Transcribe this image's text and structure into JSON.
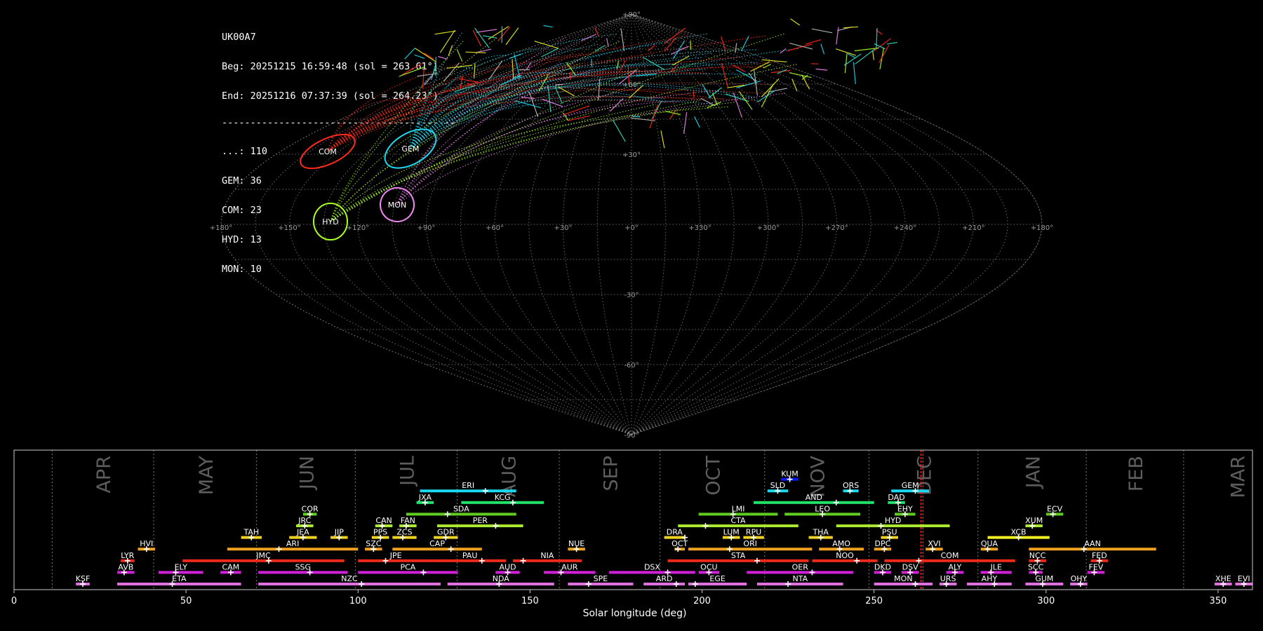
{
  "header": {
    "station": "UK00A7",
    "begin": "Beg: 20251215 16:59:48 (sol = 263.61°)",
    "end": "End: 20251216 07:37:39 (sol = 264.23°)",
    "separator": "-----------------------------------------",
    "counts": [
      {
        "label": "...: 110"
      },
      {
        "label": "GEM: 36"
      },
      {
        "label": "COM: 23"
      },
      {
        "label": "HYD: 13"
      },
      {
        "label": "MON: 10"
      }
    ]
  },
  "sky_map": {
    "lat_labels": [
      "+90°",
      "+60°",
      "+30°",
      "-30°",
      "-60°",
      "-90°"
    ],
    "lon_labels": [
      "+180°",
      "+150°",
      "+120°",
      "+90°",
      "+60°",
      "+30°",
      "+0°",
      "+330°",
      "+300°",
      "+270°",
      "+240°",
      "+210°",
      "+180°"
    ],
    "radiants": [
      {
        "code": "COM",
        "color": "#ff2a1a"
      },
      {
        "code": "GEM",
        "color": "#1fd8f0"
      },
      {
        "code": "MON",
        "color": "#ee88ee"
      },
      {
        "code": "HYD",
        "color": "#aaff22"
      }
    ]
  },
  "chart_data": {
    "type": "timeline",
    "xlabel": "Solar longitude (deg)",
    "xlim": [
      0,
      360
    ],
    "xticks": [
      0,
      50,
      100,
      150,
      200,
      250,
      300,
      350
    ],
    "current_sol": [
      263.61,
      264.23
    ],
    "months": [
      {
        "name": "APR",
        "start": 11.1
      },
      {
        "name": "MAY",
        "start": 40.6
      },
      {
        "name": "JUN",
        "start": 70.5
      },
      {
        "name": "JUL",
        "start": 99.2
      },
      {
        "name": "AUG",
        "start": 128.8
      },
      {
        "name": "SEP",
        "start": 158.5
      },
      {
        "name": "OCT",
        "start": 187.8
      },
      {
        "name": "NOV",
        "start": 218.2
      },
      {
        "name": "DEC",
        "start": 248.5
      },
      {
        "name": "JAN",
        "start": 280.2
      },
      {
        "name": "FEB",
        "start": 311.7
      },
      {
        "name": "MAR",
        "start": 340.0
      }
    ],
    "showers": [
      {
        "code": "KUM",
        "start": 223,
        "end": 228,
        "peak": 225.5,
        "row": 9,
        "color": "#0a1aee"
      },
      {
        "code": "ERI",
        "start": 118,
        "end": 146,
        "peak": 137,
        "row": 8,
        "color": "#1ad8f0"
      },
      {
        "code": "SLD",
        "start": 219,
        "end": 225,
        "peak": 222,
        "row": 8,
        "color": "#1ad8f0"
      },
      {
        "code": "ORS",
        "start": 241,
        "end": 245.5,
        "peak": 243,
        "row": 8,
        "color": "#1ad8f0"
      },
      {
        "code": "GEM",
        "start": 255,
        "end": 266,
        "peak": 262,
        "row": 8,
        "color": "#1ad8f0"
      },
      {
        "code": "JXA",
        "start": 117,
        "end": 122,
        "peak": 119.5,
        "row": 7,
        "color": "#22e36a"
      },
      {
        "code": "KCG",
        "start": 130,
        "end": 154,
        "peak": 145,
        "row": 7,
        "color": "#22e36a"
      },
      {
        "code": "AND",
        "start": 215,
        "end": 250,
        "peak": 239,
        "row": 7,
        "color": "#22e36a"
      },
      {
        "code": "DAD",
        "start": 254,
        "end": 259,
        "peak": 257,
        "row": 7,
        "color": "#22e36a"
      },
      {
        "code": "COR",
        "start": 84,
        "end": 88,
        "peak": 86,
        "row": 6,
        "color": "#5fcc22"
      },
      {
        "code": "SDA",
        "start": 114,
        "end": 146,
        "peak": 126,
        "row": 6,
        "color": "#5fcc22"
      },
      {
        "code": "LMI",
        "start": 199,
        "end": 222,
        "peak": 209,
        "row": 6,
        "color": "#5fcc22"
      },
      {
        "code": "LEO",
        "start": 224,
        "end": 246,
        "peak": 235,
        "row": 6,
        "color": "#5fcc22"
      },
      {
        "code": "EHY",
        "start": 256,
        "end": 262,
        "peak": 259,
        "row": 6,
        "color": "#5fcc22"
      },
      {
        "code": "ECV",
        "start": 300,
        "end": 305,
        "peak": 302,
        "row": 6,
        "color": "#5fcc22"
      },
      {
        "code": "JRC",
        "start": 82,
        "end": 87,
        "peak": 84.5,
        "row": 5,
        "color": "#a8e830"
      },
      {
        "code": "CAN",
        "start": 105,
        "end": 110,
        "peak": 107,
        "row": 5,
        "color": "#a8e830"
      },
      {
        "code": "FAN",
        "start": 112,
        "end": 117,
        "peak": 114,
        "row": 5,
        "color": "#a8e830"
      },
      {
        "code": "PER",
        "start": 123,
        "end": 148,
        "peak": 140,
        "row": 5,
        "color": "#a8e830"
      },
      {
        "code": "CTA",
        "start": 193,
        "end": 228,
        "peak": 201,
        "row": 5,
        "color": "#a8e830"
      },
      {
        "code": "HYD",
        "start": 239,
        "end": 272,
        "peak": 252,
        "row": 5,
        "color": "#a8e830"
      },
      {
        "code": "XUM",
        "start": 294,
        "end": 299,
        "peak": 296,
        "row": 5,
        "color": "#a8e830"
      },
      {
        "code": "TAH",
        "start": 66,
        "end": 72,
        "peak": 69,
        "row": 4,
        "color": "#f0d020"
      },
      {
        "code": "JEA",
        "start": 80,
        "end": 88,
        "peak": 84,
        "row": 4,
        "color": "#f0d020"
      },
      {
        "code": "JIP",
        "start": 92,
        "end": 97,
        "peak": 94.5,
        "row": 4,
        "color": "#f0d020"
      },
      {
        "code": "PPS",
        "start": 104,
        "end": 109,
        "peak": 106.5,
        "row": 4,
        "color": "#f0d020"
      },
      {
        "code": "ZCS",
        "start": 110,
        "end": 117,
        "peak": 113,
        "row": 4,
        "color": "#f0d020"
      },
      {
        "code": "GDR",
        "start": 122,
        "end": 129,
        "peak": 125.5,
        "row": 4,
        "color": "#f0d020"
      },
      {
        "code": "DRA",
        "start": 189,
        "end": 195,
        "peak": 195,
        "row": 4,
        "color": "#f0d020"
      },
      {
        "code": "LUM",
        "start": 206,
        "end": 211,
        "peak": 208.5,
        "row": 4,
        "color": "#f0d020"
      },
      {
        "code": "RPU",
        "start": 212,
        "end": 218,
        "peak": 215,
        "row": 4,
        "color": "#f0d020"
      },
      {
        "code": "THA",
        "start": 231,
        "end": 238,
        "peak": 234.5,
        "row": 4,
        "color": "#f0d020"
      },
      {
        "code": "PSU",
        "start": 252,
        "end": 257,
        "peak": 254.5,
        "row": 4,
        "color": "#f0d020"
      },
      {
        "code": "XCB",
        "start": 283,
        "end": 301,
        "peak": 292,
        "row": 4,
        "color": "#f0f020"
      },
      {
        "code": "HVI",
        "start": 36,
        "end": 41,
        "peak": 38.5,
        "row": 3,
        "color": "#f0a020"
      },
      {
        "code": "ARI",
        "start": 62,
        "end": 100,
        "peak": 77,
        "row": 3,
        "color": "#f0a020"
      },
      {
        "code": "SZC",
        "start": 102,
        "end": 107,
        "peak": 104.5,
        "row": 3,
        "color": "#f0a020"
      },
      {
        "code": "CAP",
        "start": 110,
        "end": 136,
        "peak": 127,
        "row": 3,
        "color": "#f0a020"
      },
      {
        "code": "NUE",
        "start": 161,
        "end": 166,
        "peak": 163.5,
        "row": 3,
        "color": "#f0a020"
      },
      {
        "code": "OCT",
        "start": 192,
        "end": 195,
        "peak": 193,
        "row": 3,
        "color": "#f0a020"
      },
      {
        "code": "ORI",
        "start": 196,
        "end": 232,
        "peak": 208,
        "row": 3,
        "color": "#f0a020"
      },
      {
        "code": "AMO",
        "start": 234,
        "end": 247,
        "peak": 240,
        "row": 3,
        "color": "#f0a020"
      },
      {
        "code": "DPC",
        "start": 250,
        "end": 255,
        "peak": 253,
        "row": 3,
        "color": "#f0a020"
      },
      {
        "code": "XVI",
        "start": 265,
        "end": 270,
        "peak": 267,
        "row": 3,
        "color": "#f0a020"
      },
      {
        "code": "QUA",
        "start": 281,
        "end": 286,
        "peak": 283,
        "row": 3,
        "color": "#f0a020"
      },
      {
        "code": "AAN",
        "start": 295,
        "end": 332,
        "peak": 311,
        "row": 3,
        "color": "#f0a020"
      },
      {
        "code": "LYR",
        "start": 31,
        "end": 35,
        "peak": 33,
        "row": 2,
        "color": "#ee2a1a"
      },
      {
        "code": "JMC",
        "start": 49,
        "end": 96,
        "peak": 74,
        "row": 2,
        "color": "#ee2a1a"
      },
      {
        "code": "JPE",
        "start": 100,
        "end": 122,
        "peak": 108,
        "row": 2,
        "color": "#ee2a1a"
      },
      {
        "code": "PAU",
        "start": 122,
        "end": 143,
        "peak": 136,
        "row": 2,
        "color": "#ee2a1a"
      },
      {
        "code": "NIA",
        "start": 145,
        "end": 165,
        "peak": 148,
        "row": 2,
        "color": "#ee2a1a"
      },
      {
        "code": "STA",
        "start": 190,
        "end": 231,
        "peak": 216,
        "row": 2,
        "color": "#ee2a1a"
      },
      {
        "code": "NOO",
        "start": 232,
        "end": 251,
        "peak": 245,
        "row": 2,
        "color": "#ee2a1a"
      },
      {
        "code": "COM",
        "start": 253,
        "end": 291,
        "peak": 263,
        "row": 2,
        "color": "#ee2a1a"
      },
      {
        "code": "NCC",
        "start": 295,
        "end": 300,
        "peak": 297.5,
        "row": 2,
        "color": "#ee2a1a"
      },
      {
        "code": "FED",
        "start": 313,
        "end": 318,
        "peak": 315.5,
        "row": 2,
        "color": "#ee2a1a"
      },
      {
        "code": "AVB",
        "start": 30,
        "end": 35,
        "peak": 32,
        "row": 1,
        "color": "#d020d8"
      },
      {
        "code": "ELY",
        "start": 42,
        "end": 55,
        "peak": 47,
        "row": 1,
        "color": "#d020d8"
      },
      {
        "code": "CAM",
        "start": 60,
        "end": 66,
        "peak": 63,
        "row": 1,
        "color": "#d020d8"
      },
      {
        "code": "SSG",
        "start": 71,
        "end": 97,
        "peak": 86,
        "row": 1,
        "color": "#d020d8"
      },
      {
        "code": "PCA",
        "start": 100,
        "end": 129,
        "peak": 119,
        "row": 1,
        "color": "#d020d8"
      },
      {
        "code": "AUD",
        "start": 140,
        "end": 147,
        "peak": 143.5,
        "row": 1,
        "color": "#d020d8"
      },
      {
        "code": "AUR",
        "start": 154,
        "end": 169,
        "peak": 159,
        "row": 1,
        "color": "#d020d8"
      },
      {
        "code": "DSX",
        "start": 173,
        "end": 198,
        "peak": 190,
        "row": 1,
        "color": "#d020d8"
      },
      {
        "code": "OCU",
        "start": 199,
        "end": 205,
        "peak": 202,
        "row": 1,
        "color": "#d020d8"
      },
      {
        "code": "OER",
        "start": 213,
        "end": 244,
        "peak": 232,
        "row": 1,
        "color": "#d020d8"
      },
      {
        "code": "DKD",
        "start": 250,
        "end": 255,
        "peak": 252.5,
        "row": 1,
        "color": "#d020d8"
      },
      {
        "code": "DSV",
        "start": 258,
        "end": 263,
        "peak": 260.5,
        "row": 1,
        "color": "#d020d8"
      },
      {
        "code": "ALY",
        "start": 271,
        "end": 276,
        "peak": 273.5,
        "row": 1,
        "color": "#d020d8"
      },
      {
        "code": "JLE",
        "start": 281,
        "end": 290,
        "peak": 284,
        "row": 1,
        "color": "#d020d8"
      },
      {
        "code": "SCC",
        "start": 295,
        "end": 299,
        "peak": 297,
        "row": 1,
        "color": "#d020d8"
      },
      {
        "code": "FEV",
        "start": 312,
        "end": 317,
        "peak": 314,
        "row": 1,
        "color": "#d020d8"
      },
      {
        "code": "KSF",
        "start": 18,
        "end": 22,
        "peak": 20,
        "row": 0,
        "color": "#e070e0"
      },
      {
        "code": "ETA",
        "start": 30,
        "end": 66,
        "peak": 46,
        "row": 0,
        "color": "#e070e0"
      },
      {
        "code": "NZC",
        "start": 71,
        "end": 124,
        "peak": 101,
        "row": 0,
        "color": "#e070e0"
      },
      {
        "code": "NDA",
        "start": 126,
        "end": 157,
        "peak": 141,
        "row": 0,
        "color": "#e070e0"
      },
      {
        "code": "SPE",
        "start": 161,
        "end": 180,
        "peak": 167,
        "row": 0,
        "color": "#e070e0"
      },
      {
        "code": "ARD",
        "start": 183,
        "end": 195,
        "peak": 192.5,
        "row": 0,
        "color": "#e070e0"
      },
      {
        "code": "EGE",
        "start": 196,
        "end": 213,
        "peak": 198,
        "row": 0,
        "color": "#e070e0"
      },
      {
        "code": "NTA",
        "start": 216,
        "end": 241,
        "peak": 225,
        "row": 0,
        "color": "#e070e0"
      },
      {
        "code": "MON",
        "start": 250,
        "end": 267,
        "peak": 262,
        "row": 0,
        "color": "#e070e0"
      },
      {
        "code": "URS",
        "start": 269,
        "end": 274,
        "peak": 271,
        "row": 0,
        "color": "#e070e0"
      },
      {
        "code": "AHY",
        "start": 277,
        "end": 290,
        "peak": 285,
        "row": 0,
        "color": "#e070e0"
      },
      {
        "code": "GUM",
        "start": 294,
        "end": 305,
        "peak": 299,
        "row": 0,
        "color": "#e070e0"
      },
      {
        "code": "OHY",
        "start": 307,
        "end": 312,
        "peak": 310,
        "row": 0,
        "color": "#e070e0"
      },
      {
        "code": "XHE",
        "start": 349,
        "end": 354,
        "peak": 351.5,
        "row": 0,
        "color": "#e070e0"
      },
      {
        "code": "EVI",
        "start": 355,
        "end": 360,
        "peak": 357.5,
        "row": 0,
        "color": "#e070e0"
      }
    ]
  }
}
